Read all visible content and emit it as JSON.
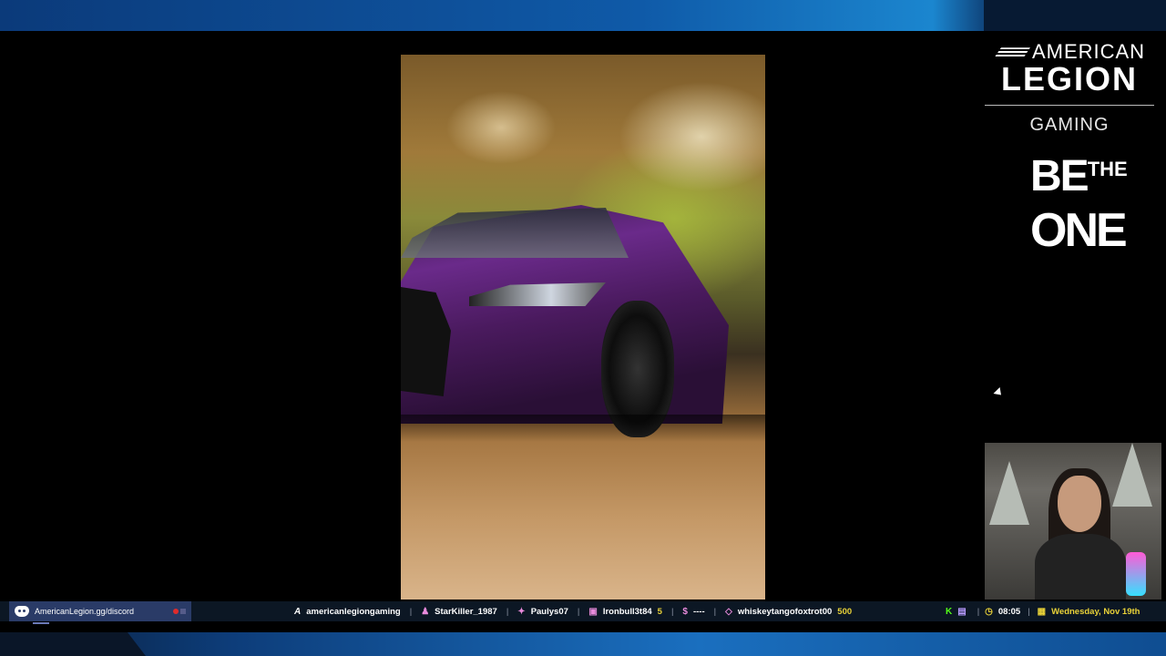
{
  "brand": {
    "line1": "AMERICAN",
    "line2": "LEGION",
    "line3": "GAMING",
    "tagline_be": "BE",
    "tagline_the": "THE",
    "tagline_one": "ONE"
  },
  "ticker": {
    "discord_link": "AmericanLegion.gg/discord",
    "channel": "americanlegiongaming",
    "latest_follower": "StarKiller_1987",
    "latest_sub": "Paulys07",
    "gift_user": "Ironbull3t84",
    "gift_count": "5",
    "donation": "----",
    "bits_user": "whiskeytangofoxtrot00",
    "bits_amount": "500",
    "time": "08:05",
    "date": "Wednesday, Nov 19th"
  },
  "colors": {
    "accent": "#e9d238",
    "discord_bg": "#2a3b67",
    "taskbar_bg": "#0c1724",
    "kick_green": "#53fc18",
    "twitch_purple": "#9146ff"
  },
  "icons": {
    "discord": "discord-icon",
    "channel": "american-legion-logo-icon",
    "follower": "person-icon",
    "sub": "star-icon",
    "gift": "gift-icon",
    "donation": "dollar-icon",
    "bits": "diamond-icon",
    "kick": "kick-icon",
    "twitch": "twitch-icon",
    "clock": "clock-icon",
    "calendar": "calendar-icon"
  }
}
